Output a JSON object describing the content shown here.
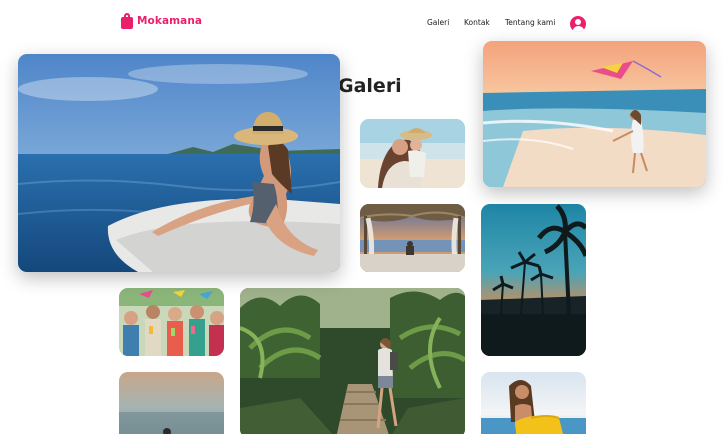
{
  "brand": {
    "name": "Mokamana",
    "color": "#ec1f6d"
  },
  "nav": {
    "items": [
      "Galeri",
      "Kontak",
      "Tentang kami"
    ]
  },
  "page": {
    "title": "Galeri"
  },
  "icons": {
    "brand": "shopping-bag-icon",
    "user": "user-avatar-icon"
  },
  "gallery": {
    "photos": [
      {
        "name": "woman-infinity-pool-photo"
      },
      {
        "name": "girl-kite-beach-photo"
      },
      {
        "name": "mother-child-beach-photo"
      },
      {
        "name": "beach-cabana-photo"
      },
      {
        "name": "palm-sunset-photo"
      },
      {
        "name": "friends-toast-photo"
      },
      {
        "name": "jungle-hiker-photo"
      },
      {
        "name": "blurred-beach-photo"
      },
      {
        "name": "yellow-towel-beach-photo"
      }
    ]
  }
}
